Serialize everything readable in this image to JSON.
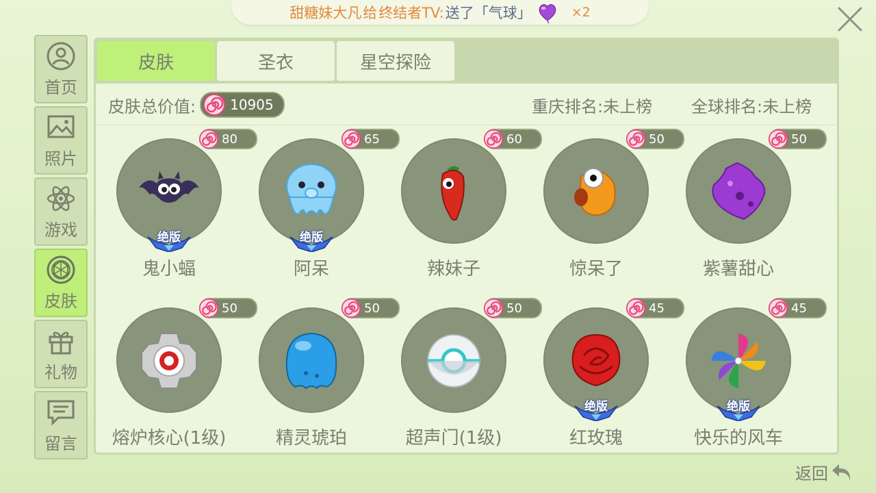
{
  "banner": {
    "sender": "甜糖妹大凡",
    "connector": "给",
    "receiver": "终结者TV:",
    "message": "送了「气球」",
    "count": "×2"
  },
  "sidebar": {
    "items": [
      {
        "label": "首页",
        "icon": "user-icon"
      },
      {
        "label": "照片",
        "icon": "photo-icon"
      },
      {
        "label": "游戏",
        "icon": "atom-icon"
      },
      {
        "label": "皮肤",
        "icon": "skin-icon",
        "active": true
      },
      {
        "label": "礼物",
        "icon": "gift-icon"
      },
      {
        "label": "留言",
        "icon": "message-icon"
      }
    ]
  },
  "tabs": [
    {
      "label": "皮肤",
      "active": true
    },
    {
      "label": "圣衣"
    },
    {
      "label": "星空探险"
    }
  ],
  "summary": {
    "total_label": "皮肤总价值:",
    "total_value": "10905",
    "local_rank": "重庆排名:未上榜",
    "global_rank": "全球排名:未上榜"
  },
  "skins": [
    {
      "name": "鬼小蝠",
      "price": "80",
      "badge": "绝版",
      "art": "bat"
    },
    {
      "name": "阿呆",
      "price": "65",
      "badge": "绝版",
      "art": "octopus"
    },
    {
      "name": "辣妹子",
      "price": "60",
      "art": "pepper"
    },
    {
      "name": "惊呆了",
      "price": "50",
      "art": "bird"
    },
    {
      "name": "紫薯甜心",
      "price": "50",
      "art": "purple-blob"
    },
    {
      "name": "熔炉核心(1级)",
      "price": "50",
      "art": "core"
    },
    {
      "name": "精灵琥珀",
      "price": "50",
      "art": "blue-blob"
    },
    {
      "name": "超声门(1级)",
      "price": "50",
      "art": "sphere"
    },
    {
      "name": "红玫瑰",
      "price": "45",
      "badge": "绝版",
      "art": "rose"
    },
    {
      "name": "快乐的风车",
      "price": "45",
      "badge": "绝版",
      "art": "pinwheel"
    }
  ],
  "back_label": "返回",
  "colors": {
    "active_tab": "#bff07a",
    "banner_text": "#e28a3c",
    "candy_pink": "#e8457a"
  }
}
